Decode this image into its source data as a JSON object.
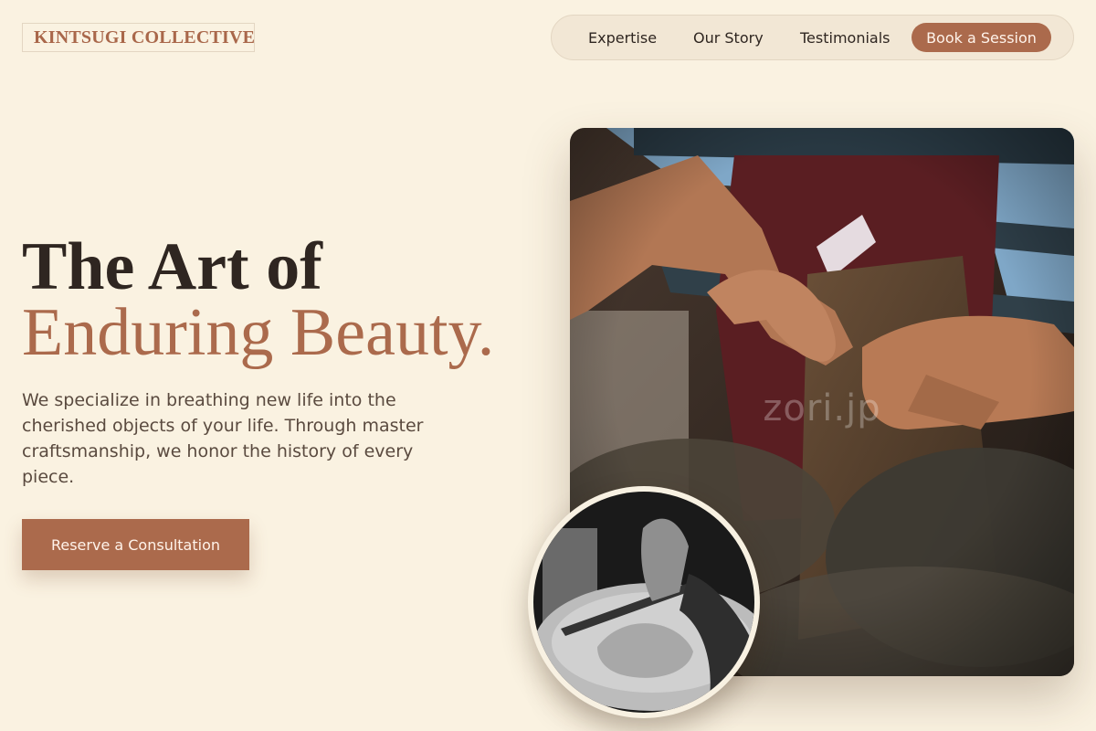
{
  "brand": {
    "name": "KINTSUGI COLLECTIVE"
  },
  "nav": {
    "items": [
      {
        "label": "Expertise"
      },
      {
        "label": "Our Story"
      },
      {
        "label": "Testimonials"
      }
    ],
    "cta_label": "Book a Session"
  },
  "hero": {
    "title_line1": "The Art of",
    "title_line2": "Enduring Beauty.",
    "description": "We specialize in breathing new life into the cherished objects of your life. Through master craftsmanship, we honor the history of every piece.",
    "button_label": "Reserve a Consultation"
  },
  "media": {
    "main_photo_watermark": "zori.jp",
    "main_photo_subject": "craftsman hands carving wood",
    "inset_photo_subject": "black and white hands carving wood with chisel"
  },
  "colors": {
    "background": "#faf2e1",
    "accent": "#ab6a4c",
    "text_dark": "#2f2621",
    "text_body": "#5a4a3f"
  }
}
